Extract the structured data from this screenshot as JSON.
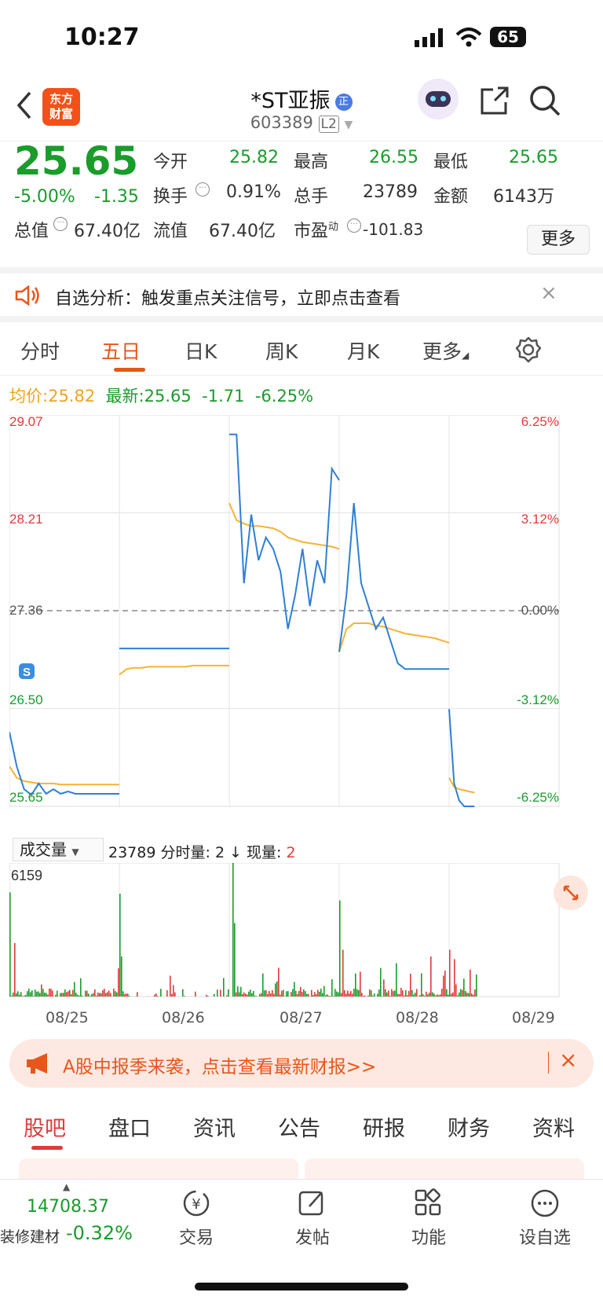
{
  "status": {
    "time": "10:27",
    "battery": "65"
  },
  "header": {
    "logo_line1": "东方",
    "logo_line2": "财富",
    "title": "*ST亚振",
    "badge": "正",
    "code": "603389",
    "level": "L2"
  },
  "quote": {
    "price": "25.65",
    "change_pct": "-5.00%",
    "change": "-1.35",
    "open_label": "今开",
    "open": "25.82",
    "high_label": "最高",
    "high": "26.55",
    "low_label": "最低",
    "low": "25.65",
    "turnover_label": "换手",
    "turnover": "0.91%",
    "volume_label": "总手",
    "volume": "23789",
    "amount_label": "金额",
    "amount": "6143万",
    "mcap_label": "总值",
    "mcap": "67.40亿",
    "float_label": "流值",
    "float": "67.40亿",
    "pe_label": "市盈",
    "pe_sup": "动",
    "pe": "-101.83",
    "more": "更多"
  },
  "notice": {
    "text": "自选分析：触发重点关注信号，立即点击查看"
  },
  "tabs": [
    "分时",
    "五日",
    "日K",
    "周K",
    "月K",
    "更多"
  ],
  "info": {
    "avg_label": "均价:",
    "avg": "25.82",
    "latest_label": "最新:",
    "latest": "25.65",
    "chg": "-1.71",
    "pct": "-6.25%"
  },
  "chart_data": {
    "type": "line",
    "y_left_ticks": [
      "29.07",
      "28.21",
      "27.36",
      "26.50",
      "25.65"
    ],
    "y_right_ticks": [
      "6.25%",
      "3.12%",
      "0.00%",
      "-3.12%",
      "-6.25%"
    ],
    "x_labels": [
      "08/25",
      "08/26",
      "08/27",
      "08/28",
      "08/29"
    ],
    "ylim": [
      25.65,
      29.07
    ],
    "prev_close": 27.36,
    "series": [
      {
        "name": "最新",
        "color": "#2f7fd6",
        "days": [
          [
            26.3,
            26.0,
            25.8,
            25.75,
            25.85,
            25.76,
            25.8,
            25.76,
            25.78,
            25.76,
            25.76,
            25.76,
            25.76,
            25.76,
            25.76,
            25.76
          ],
          [
            27.03,
            27.03,
            27.03,
            27.03,
            27.03,
            27.03,
            27.03,
            27.03,
            27.03,
            27.03,
            27.03,
            27.03,
            27.03,
            27.03,
            27.03,
            27.03
          ],
          [
            28.9,
            28.9,
            27.6,
            28.2,
            27.8,
            28.0,
            27.9,
            27.7,
            27.2,
            27.5,
            27.9,
            27.4,
            27.8,
            27.6,
            28.6,
            28.5
          ],
          [
            27.0,
            27.5,
            28.3,
            27.6,
            27.4,
            27.2,
            27.3,
            27.1,
            26.9,
            26.85,
            26.85,
            26.85,
            26.85,
            26.85,
            26.85,
            26.85
          ],
          [
            26.5,
            25.85,
            25.7,
            25.65,
            25.65,
            25.65
          ]
        ]
      },
      {
        "name": "均价",
        "color": "#f5b335",
        "days": [
          [
            26.0,
            25.9,
            25.87,
            25.86,
            25.85,
            25.85,
            25.85,
            25.84,
            25.84,
            25.84,
            25.84,
            25.84,
            25.84,
            25.84,
            25.84,
            25.84
          ],
          [
            26.8,
            26.85,
            26.86,
            26.86,
            26.87,
            26.87,
            26.87,
            26.87,
            26.87,
            26.87,
            26.88,
            26.88,
            26.88,
            26.88,
            26.88,
            26.88
          ],
          [
            28.3,
            28.15,
            28.12,
            28.1,
            28.1,
            28.09,
            28.08,
            28.05,
            28.0,
            27.98,
            27.96,
            27.95,
            27.94,
            27.93,
            27.92,
            27.9
          ],
          [
            27.0,
            27.2,
            27.25,
            27.25,
            27.25,
            27.23,
            27.22,
            27.2,
            27.18,
            27.16,
            27.15,
            27.14,
            27.13,
            27.12,
            27.1,
            27.08
          ],
          [
            25.9,
            25.82,
            25.8,
            25.79,
            25.78,
            25.77
          ]
        ]
      }
    ]
  },
  "volume": {
    "selector": "成交量",
    "total": "23789",
    "minute_label": "分时量:",
    "minute": "2",
    "current_label": "现量:",
    "current": "2",
    "max": "6159"
  },
  "banner": {
    "text": "A股中报季来袭，点击查看最新财报>>"
  },
  "bottom_tabs": [
    "股吧",
    "盘口",
    "资讯",
    "公告",
    "研报",
    "财务",
    "资料"
  ],
  "tabbar": {
    "index_value": "14708.37",
    "index_name": "装修建材",
    "index_pct": "-0.32%",
    "items": [
      "交易",
      "发帖",
      "功能",
      "设自选"
    ]
  }
}
